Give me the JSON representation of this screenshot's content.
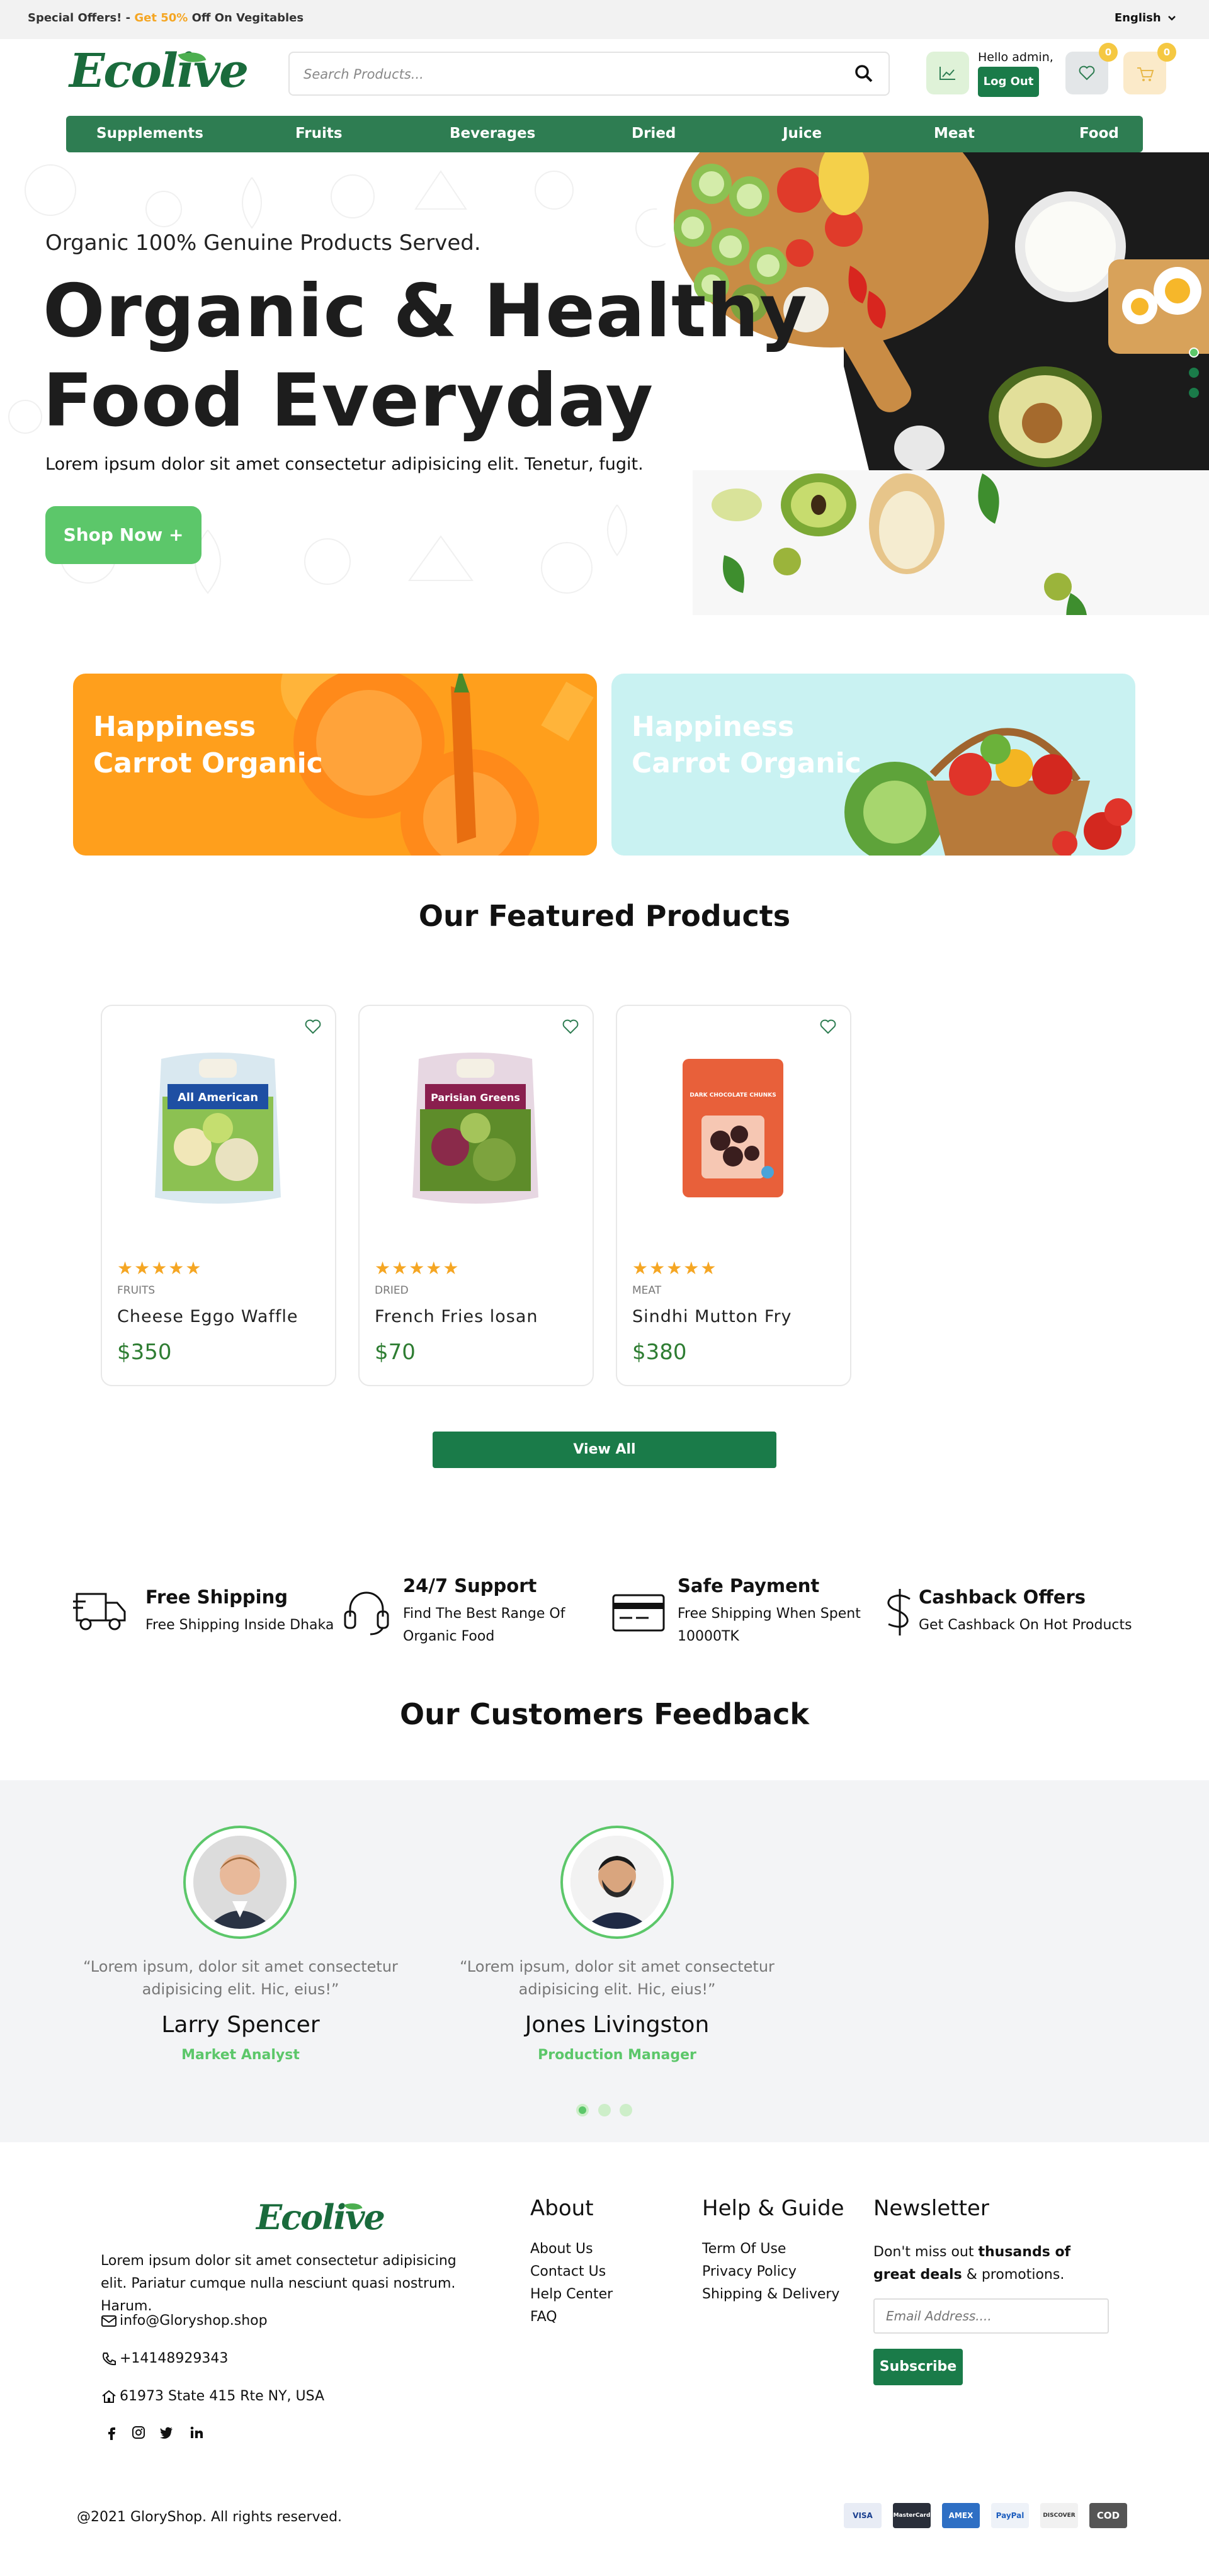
{
  "topbar": {
    "offer_prefix": "Special Offers! -",
    "offer_highlight": "Get 50%",
    "offer_suffix": "Off On Vegitables",
    "language": "English"
  },
  "header": {
    "logo": "Ecolive",
    "search_placeholder": "Search Products...",
    "hello": "Hello admin,",
    "logout": "Log Out",
    "wishlist_count": "0",
    "cart_count": "0"
  },
  "nav": [
    "Supplements",
    "Fruits",
    "Beverages",
    "Dried",
    "Juice",
    "Meat",
    "Food"
  ],
  "hero": {
    "subtitle": "Organic 100% Genuine Products Served.",
    "title_line1": "Organic & Healthy",
    "title_line2": "Food Everyday",
    "description": "Lorem ipsum dolor sit amet consectetur adipisicing elit. Tenetur, fugit.",
    "cta": "Shop Now +"
  },
  "banners": [
    {
      "line1": "Happiness",
      "line2": "Carrot Organic",
      "color": "#ff9f1c"
    },
    {
      "line1": "Happiness",
      "line2": "Carrot Organic",
      "color": "#c9f2f2"
    }
  ],
  "featured": {
    "title": "Our Featured Products",
    "products": [
      {
        "category": "FRUITS",
        "name": "Cheese Eggo Waffle",
        "price": "$350",
        "stars": "★★★★★",
        "pack_label": "All American",
        "pack_color": "#1e4fa3"
      },
      {
        "category": "DRIED",
        "name": "French Fries losan",
        "price": "$70",
        "stars": "★★★★★",
        "pack_label": "Parisian Greens",
        "pack_color": "#8a1f4e"
      },
      {
        "category": "MEAT",
        "name": "Sindhi Mutton Fry",
        "price": "$380",
        "stars": "★★★★★",
        "pack_label": "DARK CHOCOLATE CHUNKS",
        "pack_color": "#e8603a"
      }
    ],
    "view_all": "View All"
  },
  "features": [
    {
      "title": "Free Shipping",
      "desc": "Free Shipping Inside Dhaka",
      "icon": "truck-icon"
    },
    {
      "title": "24/7 Support",
      "desc": "Find The Best Range Of Organic Food",
      "icon": "headset-icon"
    },
    {
      "title": "Safe Payment",
      "desc": "Free Shipping When Spent 10000TK",
      "icon": "card-icon"
    },
    {
      "title": "Cashback Offers",
      "desc": "Get Cashback On Hot Products",
      "icon": "dollar-icon"
    }
  ],
  "feedback": {
    "title": "Our Customers Feedback",
    "testimonials": [
      {
        "quote": "“Lorem ipsum, dolor sit amet consectetur adipisicing elit. Hic, eius!”",
        "name": "Larry Spencer",
        "role": "Market Analyst"
      },
      {
        "quote": "“Lorem ipsum, dolor sit amet consectetur adipisicing elit. Hic, eius!”",
        "name": "Jones Livingston",
        "role": "Production Manager"
      }
    ]
  },
  "footer": {
    "logo": "Ecolive",
    "about_text": "Lorem ipsum dolor sit amet consectetur adipisicing elit. Pariatur cumque nulla nesciunt quasi nostrum. Harum.",
    "email": "info@Gloryshop.shop",
    "phone": "+14148929343",
    "address": "61973 State 415 Rte NY, USA",
    "about": {
      "title": "About",
      "links": [
        "About Us",
        "Contact Us",
        "Help Center",
        "FAQ"
      ]
    },
    "help": {
      "title": "Help & Guide",
      "links": [
        "Term Of Use",
        "Privacy Policy",
        "Shipping & Delivery"
      ]
    },
    "newsletter": {
      "title": "Newsletter",
      "text_pre": "Don't miss out ",
      "text_bold": "thusands of great deals",
      "text_post": " & promotions.",
      "placeholder": "Email Address....",
      "button": "Subscribe"
    },
    "copyright": "@2021 GloryShop. All rights reserved.",
    "payments": [
      "VISA",
      "MasterCard",
      "AMEX",
      "PayPal",
      "DISCOVER",
      "COD"
    ]
  },
  "colors": {
    "brand_green": "#1a7b49",
    "accent_green": "#5cc76a",
    "accent_orange": "#f5a623"
  }
}
